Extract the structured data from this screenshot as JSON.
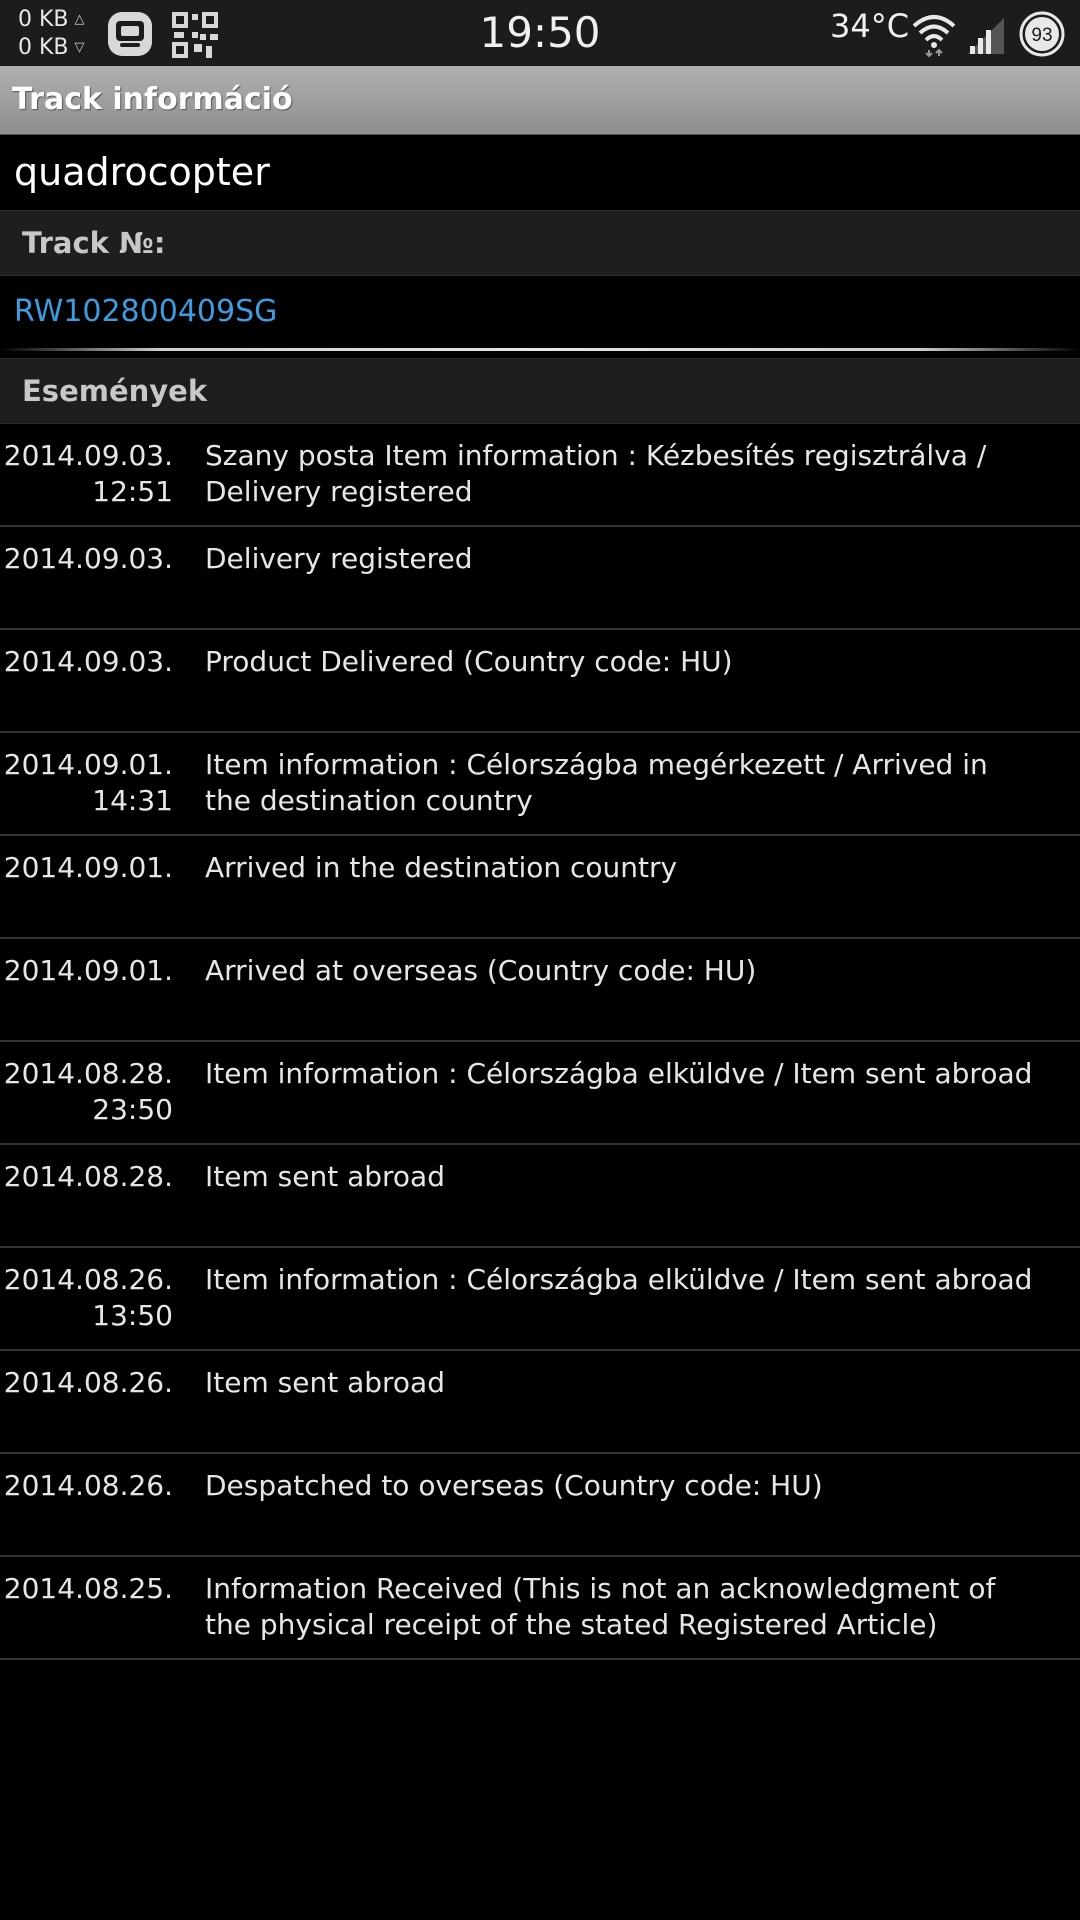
{
  "status_bar": {
    "net_up": "0 KB",
    "net_down": "0 KB",
    "up_arrow": "△",
    "down_arrow": "▽",
    "time": "19:50",
    "temperature": "34°C",
    "battery": "93",
    "icons": [
      "app-chat-icon",
      "qr-code-icon",
      "wifi-icon",
      "cell-signal-icon",
      "battery-icon"
    ]
  },
  "titlebar": {
    "title": "Track információ"
  },
  "item": {
    "name": "quadrocopter",
    "track_label": "Track №:",
    "track_number": "RW102800409SG"
  },
  "events_section": {
    "label": "Események",
    "items": [
      {
        "date": "2014.09.03.",
        "time": "12:51",
        "text": "Szany posta Item information : Kézbesítés regisztrálva / Delivery registered"
      },
      {
        "date": "2014.09.03.",
        "time": "",
        "text": "Delivery registered"
      },
      {
        "date": "2014.09.03.",
        "time": "",
        "text": "Product Delivered (Country code: HU)"
      },
      {
        "date": "2014.09.01.",
        "time": "14:31",
        "text": "Item information : Célországba megérkezett / Arrived in the destination country"
      },
      {
        "date": "2014.09.01.",
        "time": "",
        "text": "Arrived in the destination country"
      },
      {
        "date": "2014.09.01.",
        "time": "",
        "text": "Arrived at overseas (Country code: HU)"
      },
      {
        "date": "2014.08.28.",
        "time": "23:50",
        "text": "Item information : Célországba elküldve / Item sent abroad"
      },
      {
        "date": "2014.08.28.",
        "time": "",
        "text": "Item sent abroad"
      },
      {
        "date": "2014.08.26.",
        "time": "13:50",
        "text": "Item information : Célországba elküldve / Item sent abroad"
      },
      {
        "date": "2014.08.26.",
        "time": "",
        "text": "Item sent abroad"
      },
      {
        "date": "2014.08.26.",
        "time": "",
        "text": "Despatched to overseas (Country code: HU)"
      },
      {
        "date": "2014.08.25.",
        "time": "",
        "text": "Information Received (This is not an acknowledgment of the physical receipt of the stated Registered Article)"
      }
    ]
  },
  "colors": {
    "link": "#3d9be0",
    "background": "#000000",
    "titlebar": "#9e9e9e"
  }
}
